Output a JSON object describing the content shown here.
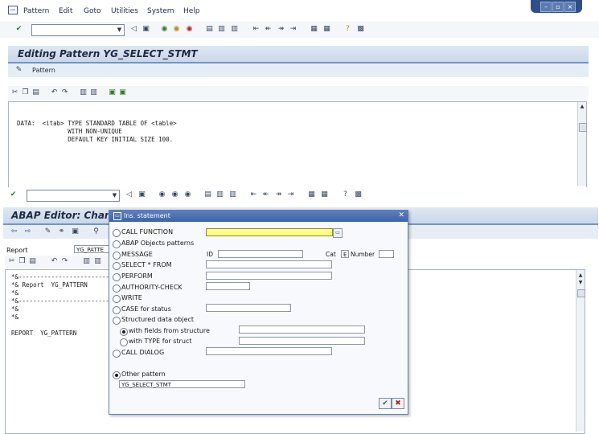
{
  "menu": {
    "items": [
      "Pattern",
      "Edit",
      "Goto",
      "Utilities",
      "System",
      "Help"
    ]
  },
  "window": {
    "title": "Editing Pattern YG_SELECT_STMT",
    "pattern_button_label": "Pattern"
  },
  "editor_top": {
    "code": "DATA:  <itab> TYPE STANDARD TABLE OF <table>\n              WITH NON-UNIQUE\n              DEFAULT KEY INITIAL SIZE 100."
  },
  "abap_editor": {
    "title": "ABAP Editor: Chan",
    "report_label": "Report",
    "report_value": "YG_PATTE",
    "code": "*&-----------------------------------\n*& Report  YG_PATTERN\n*&\n*&-----------------------------------\n*&\n*&\n\nREPORT  YG_PATTERN"
  },
  "dialog": {
    "title": "Ins. statement",
    "options": {
      "call_function": "CALL FUNCTION",
      "abap_objects": "ABAP Objects patterns",
      "message": "MESSAGE",
      "select_from": "SELECT * FROM",
      "perform": "PERFORM",
      "authority_check": "AUTHORITY-CHECK",
      "write": "WRITE",
      "case_for_status": "CASE for status",
      "structured_data_object": "Structured data object",
      "with_fields": "with fields from structure",
      "with_type": "with TYPE for struct",
      "call_dialog": "CALL DIALOG",
      "other_pattern": "Other pattern"
    },
    "message_id_label": "ID",
    "cat_label": "Cat",
    "cat_value": "E",
    "number_label": "Number",
    "other_pattern_value": "YG_SELECT_STMT"
  },
  "colors": {
    "title_bar": "#3f63a5",
    "required_field": "#ffff88",
    "window_header": "#c9d7ea"
  }
}
